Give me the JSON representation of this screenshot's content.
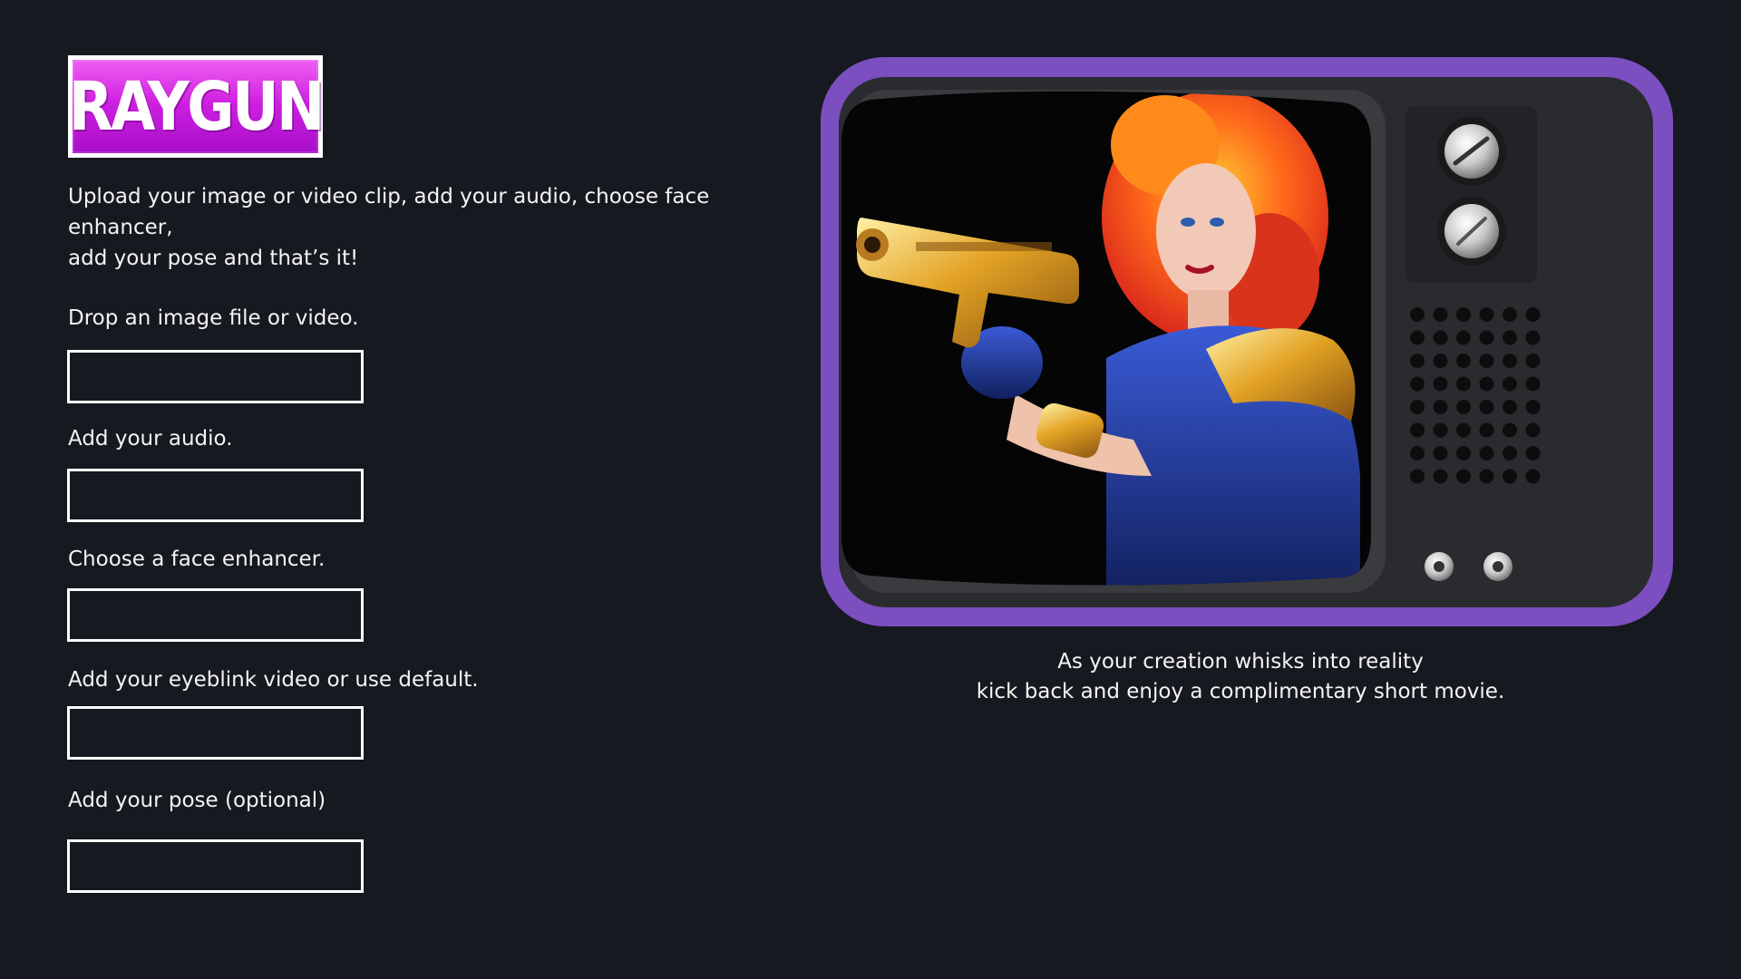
{
  "app": {
    "logo_text": "RAYGUN"
  },
  "intro": {
    "line1": "Upload your image or video clip, add your audio, choose face enhancer,",
    "line2": "add your pose and that’s it!"
  },
  "form": {
    "fields": [
      {
        "label": "Drop an image file or video."
      },
      {
        "label": "Add your audio."
      },
      {
        "label": "Choose a face enhancer."
      },
      {
        "label": "Add your eyeblink video or use default."
      },
      {
        "label": "Add your pose (optional)"
      }
    ]
  },
  "preview": {
    "caption_line1": "As your creation whisks into reality",
    "caption_line2": "kick back and enjoy a complimentary short movie."
  },
  "colors": {
    "background": "#16191f",
    "logo_gradient_top": "#f05ef2",
    "logo_gradient_bottom": "#a80fc9",
    "tv_frame": "#7b4fc0",
    "tv_body": "#2a2b2e"
  }
}
